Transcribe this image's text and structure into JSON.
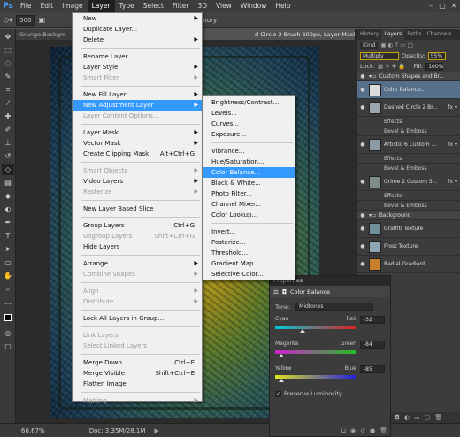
{
  "app": {
    "logo": "Ps"
  },
  "menubar": {
    "items": [
      "File",
      "Edit",
      "Image",
      "Layer",
      "Type",
      "Select",
      "Filter",
      "3D",
      "View",
      "Window",
      "Help"
    ],
    "active": "Layer"
  },
  "options_bar": {
    "size": "500",
    "opacity": "0%",
    "erase_to_history": "Erase to History"
  },
  "doc_tabs": {
    "tab1": "Grunge Backgro",
    "tab2": "d Circle 2 Brush 600px, Layer Mask/8) *"
  },
  "layer_menu": {
    "items": [
      {
        "label": "New",
        "arrow": true
      },
      {
        "label": "Duplicate Layer..."
      },
      {
        "label": "Delete",
        "arrow": true
      },
      {
        "sep": true
      },
      {
        "label": "Rename Layer..."
      },
      {
        "label": "Layer Style",
        "arrow": true
      },
      {
        "label": "Smart Filter",
        "arrow": true,
        "disabled": true
      },
      {
        "sep": true
      },
      {
        "label": "New Fill Layer",
        "arrow": true
      },
      {
        "label": "New Adjustment Layer",
        "arrow": true,
        "highlight": true
      },
      {
        "label": "Layer Content Options...",
        "disabled": true
      },
      {
        "sep": true
      },
      {
        "label": "Layer Mask",
        "arrow": true
      },
      {
        "label": "Vector Mask",
        "arrow": true
      },
      {
        "label": "Create Clipping Mask",
        "shortcut": "Alt+Ctrl+G"
      },
      {
        "sep": true
      },
      {
        "label": "Smart Objects",
        "arrow": true,
        "disabled": true
      },
      {
        "label": "Video Layers",
        "arrow": true
      },
      {
        "label": "Rasterize",
        "arrow": true,
        "disabled": true
      },
      {
        "sep": true
      },
      {
        "label": "New Layer Based Slice"
      },
      {
        "sep": true
      },
      {
        "label": "Group Layers",
        "shortcut": "Ctrl+G"
      },
      {
        "label": "Ungroup Layers",
        "shortcut": "Shift+Ctrl+G",
        "disabled": true
      },
      {
        "label": "Hide Layers"
      },
      {
        "sep": true
      },
      {
        "label": "Arrange",
        "arrow": true
      },
      {
        "label": "Combine Shapes",
        "arrow": true,
        "disabled": true
      },
      {
        "sep": true
      },
      {
        "label": "Align",
        "arrow": true,
        "disabled": true
      },
      {
        "label": "Distribute",
        "arrow": true,
        "disabled": true
      },
      {
        "sep": true
      },
      {
        "label": "Lock All Layers in Group..."
      },
      {
        "sep": true
      },
      {
        "label": "Link Layers",
        "disabled": true
      },
      {
        "label": "Select Linked Layers",
        "disabled": true
      },
      {
        "sep": true
      },
      {
        "label": "Merge Down",
        "shortcut": "Ctrl+E"
      },
      {
        "label": "Merge Visible",
        "shortcut": "Shift+Ctrl+E"
      },
      {
        "label": "Flatten Image"
      },
      {
        "sep": true
      },
      {
        "label": "Matting",
        "arrow": true,
        "disabled": true
      }
    ]
  },
  "adjust_submenu": {
    "items": [
      {
        "label": "Brightness/Contrast..."
      },
      {
        "label": "Levels..."
      },
      {
        "label": "Curves..."
      },
      {
        "label": "Exposure..."
      },
      {
        "sep": true
      },
      {
        "label": "Vibrance..."
      },
      {
        "label": "Hue/Saturation..."
      },
      {
        "label": "Color Balance...",
        "highlight": true
      },
      {
        "label": "Black & White..."
      },
      {
        "label": "Photo Filter..."
      },
      {
        "label": "Channel Mixer..."
      },
      {
        "label": "Color Lookup..."
      },
      {
        "sep": true
      },
      {
        "label": "Invert..."
      },
      {
        "label": "Posterize..."
      },
      {
        "label": "Threshold..."
      },
      {
        "label": "Gradient Map..."
      },
      {
        "label": "Selective Color..."
      }
    ]
  },
  "layers_panel": {
    "tabs": [
      "History",
      "Layers",
      "Paths",
      "Channels"
    ],
    "active_tab": "Layers",
    "kind": "Kind",
    "blend_mode": "Multiply",
    "opacity_label": "Opacity:",
    "opacity": "55%",
    "lock_label": "Lock:",
    "fill_label": "Fill:",
    "fill": "100%",
    "group_name": "Custom Shapes and Br...",
    "layers": [
      {
        "name": "Color Balance...",
        "selected": true,
        "thumb": "#dddddd"
      },
      {
        "name": "Dashed Circle 2 Br...",
        "fx": true,
        "thumb": "#9aa5b0"
      },
      {
        "effects": "Effects"
      },
      {
        "effects": "Bevel & Emboss"
      },
      {
        "name": "Artistic 6 Custom ...",
        "fx": true,
        "thumb": "#8c9aa3"
      },
      {
        "effects": "Effects"
      },
      {
        "effects": "Bevel & Emboss"
      },
      {
        "name": "Grime 2 Custom S...",
        "fx": true,
        "thumb": "#7e8d86"
      },
      {
        "effects": "Effects"
      },
      {
        "effects": "Bevel & Emboss"
      }
    ],
    "group2": "Background",
    "layers2": [
      {
        "name": "Graffiti Texture",
        "thumb": "#6f8f9a"
      },
      {
        "name": "Frost Texture",
        "thumb": "#8fa7b4"
      },
      {
        "name": "Radial Gradient",
        "thumb": "#c8812a"
      }
    ]
  },
  "properties": {
    "title": "Properties",
    "header": "Color Balance",
    "tone_label": "Tone:",
    "tone": "Midtones",
    "sliders": [
      {
        "left": "Cyan",
        "right": "Red",
        "value": "-32",
        "level": 0.34,
        "color_left": "#00c8d8",
        "color_right": "#e02020"
      },
      {
        "left": "Magenta",
        "right": "Green",
        "value": "-84",
        "level": 0.08,
        "color_left": "#d020d0",
        "color_right": "#20c020"
      },
      {
        "left": "Yellow",
        "right": "Blue",
        "value": "-85",
        "level": 0.075,
        "color_left": "#e0e020",
        "color_right": "#2020e0"
      }
    ],
    "preserve_luminosity": "Preserve Luminosity"
  },
  "statusbar": {
    "zoom": "66.67%",
    "doc": "Doc: 3.35M/28.1M"
  }
}
